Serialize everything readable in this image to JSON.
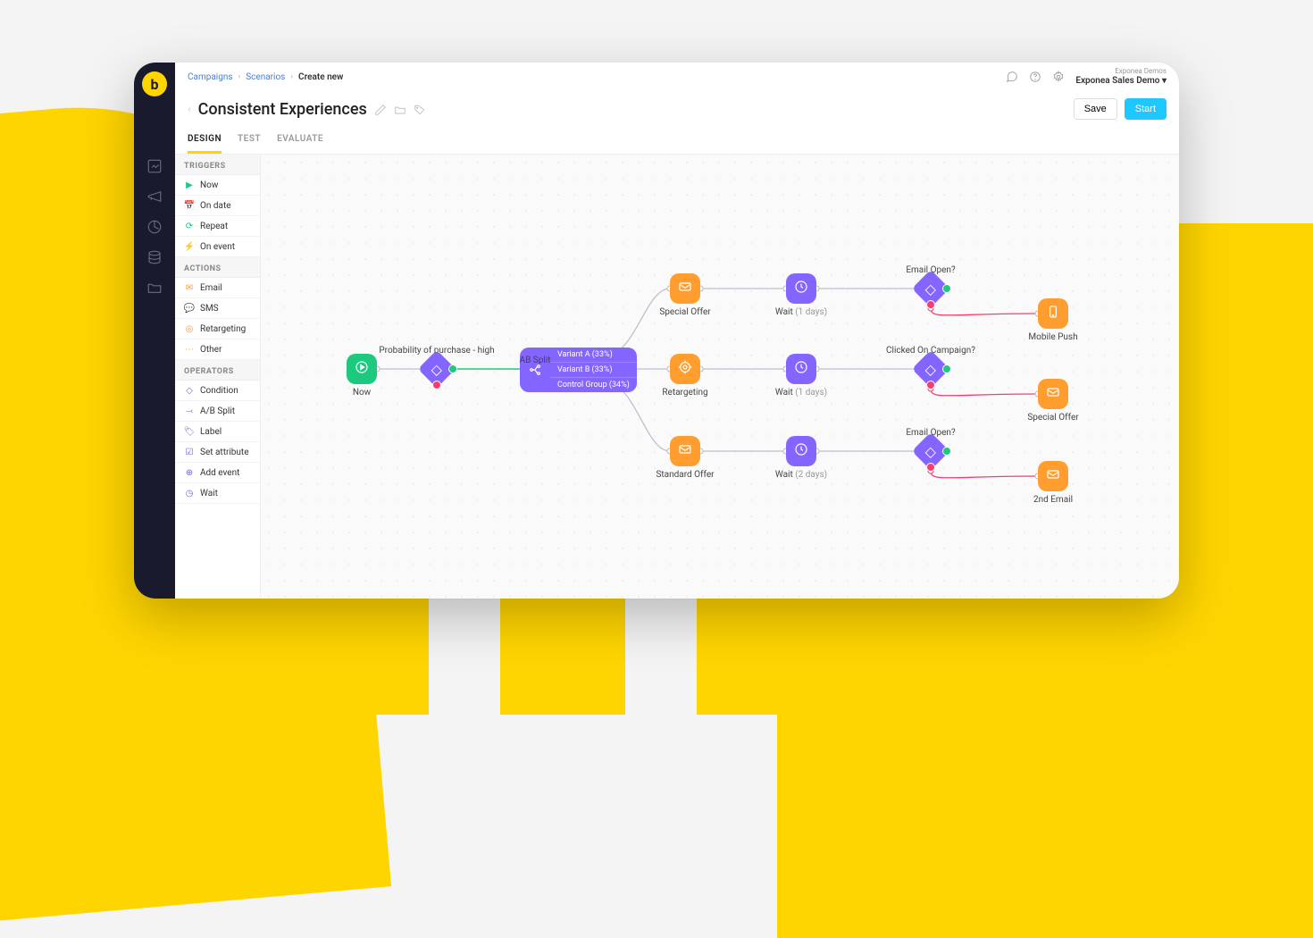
{
  "breadcrumbs": {
    "items": [
      "Campaigns",
      "Scenarios"
    ],
    "current": "Create new"
  },
  "project": {
    "org": "Exponea Demos",
    "name": "Exponea Sales Demo"
  },
  "title": "Consistent Experiences",
  "buttons": {
    "save": "Save",
    "start": "Start"
  },
  "tabs": {
    "design": "DESIGN",
    "test": "TEST",
    "evaluate": "EVALUATE"
  },
  "panel": {
    "triggers": {
      "title": "TRIGGERS",
      "items": [
        "Now",
        "On date",
        "Repeat",
        "On event"
      ]
    },
    "actions": {
      "title": "ACTIONS",
      "items": [
        "Email",
        "SMS",
        "Retargeting",
        "Other"
      ]
    },
    "operators": {
      "title": "OPERATORS",
      "items": [
        "Condition",
        "A/B Split",
        "Label",
        "Set attribute",
        "Add event",
        "Wait"
      ]
    }
  },
  "nodes": {
    "now": "Now",
    "prob": "Probability of purchase - high",
    "absplit": "AB Split",
    "absplit_rows": [
      "Variant A (33%)",
      "Variant B (33%)",
      "Control Group (34%)"
    ],
    "special_offer": "Special Offer",
    "retargeting": "Retargeting",
    "standard_offer": "Standard Offer",
    "wait1": "Wait",
    "wait1_dur": "(1 days)",
    "wait2": "Wait",
    "wait2_dur": "(1 days)",
    "wait3": "Wait",
    "wait3_dur": "(2 days)",
    "email_open1": "Email Open?",
    "clicked_campaign": "Clicked On Campaign?",
    "email_open2": "Email Open?",
    "mobile_push": "Mobile Push",
    "special_offer2": "Special Offer",
    "second_email": "2nd Email"
  }
}
